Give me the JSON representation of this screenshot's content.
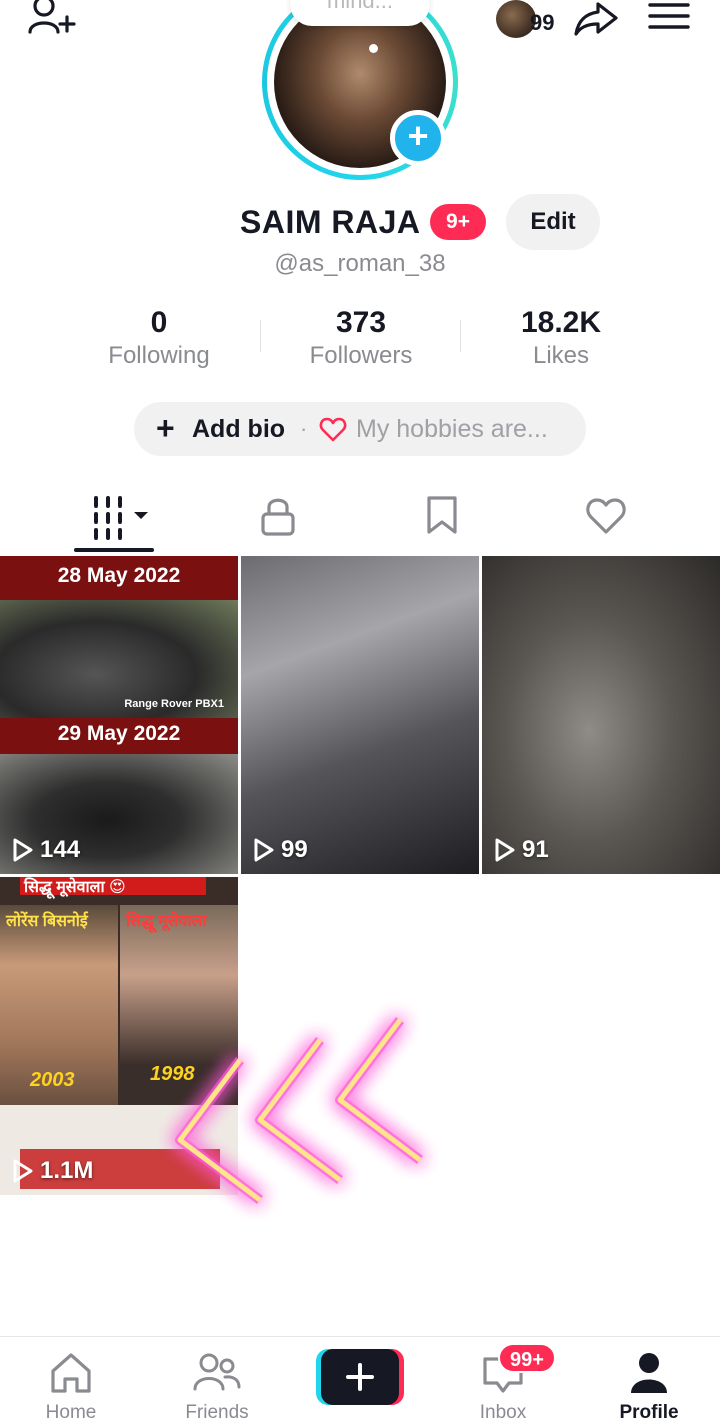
{
  "header": {
    "add_friend_icon": "person-plus-icon",
    "story_count": "99",
    "share_icon": "share-arrow-icon",
    "menu_icon": "hamburger-menu-icon"
  },
  "profile": {
    "thought_bubble": "mind...",
    "display_name": "SAIM RAJA",
    "name_badge": "9+",
    "edit_label": "Edit",
    "username": "@as_roman_38"
  },
  "stats": [
    {
      "value": "0",
      "label": "Following"
    },
    {
      "value": "373",
      "label": "Followers"
    },
    {
      "value": "18.2K",
      "label": "Likes"
    }
  ],
  "bio": {
    "add_label": "Add bio",
    "separator": "·",
    "hint": "My hobbies are..."
  },
  "tabs": [
    {
      "icon": "grid-videos-icon"
    },
    {
      "icon": "lock-icon"
    },
    {
      "icon": "bookmark-icon"
    },
    {
      "icon": "heart-outline-icon"
    }
  ],
  "videos": [
    {
      "views": "144",
      "date_top": "28 May 2022",
      "date_bottom": "29 May 2022",
      "caption": "Range Rover PBX1"
    },
    {
      "views": "99"
    },
    {
      "views": "91"
    },
    {
      "views": "1.1M",
      "banner": "सिद्धू मूसेवाला 😍",
      "left_label": "लोरेंस बिसनोई",
      "right_label": "सिद्धू मूसेवाला",
      "year_left": "2003",
      "year_right": "1998"
    }
  ],
  "nav": {
    "home": "Home",
    "friends": "Friends",
    "inbox": "Inbox",
    "inbox_badge": "99+",
    "profile": "Profile"
  },
  "colors": {
    "accent": "#fe2c55",
    "ring": "#20d5ec",
    "text": "#161823",
    "muted": "#8a8b91"
  }
}
